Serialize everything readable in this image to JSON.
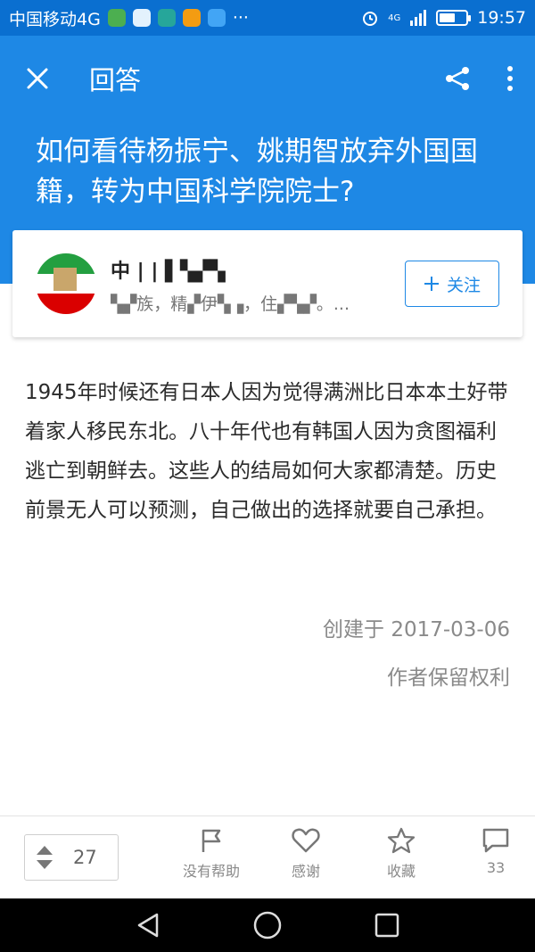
{
  "status_bar": {
    "carrier": "中国移动4G",
    "network": "4G",
    "time": "19:57",
    "battery_level": 0.6,
    "dots": "···"
  },
  "header": {
    "title": "回答",
    "question": "如何看待杨振宁、姚期智放弃外国国籍，转为中国科学院院士?"
  },
  "author": {
    "name": "中 | | ▌▚▞▚",
    "bio": "▚▞族，精▞伊▚▗，住▞▚▞。...",
    "follow_label": "关注"
  },
  "answer": {
    "text": "1945年时候还有日本人因为觉得满洲比日本本土好带着家人移民东北。八十年代也有韩国人因为贪图福利逃亡到朝鲜去。这些人的结局如何大家都清楚。历史前景无人可以预测，自己做出的选择就要自己承担。",
    "created": "创建于 2017-03-06",
    "rights": "作者保留权利"
  },
  "bottom_bar": {
    "vote_count": "27",
    "not_helpful_label": "没有帮助",
    "thanks_label": "感谢",
    "collect_label": "收藏",
    "comments_count": "33"
  },
  "colors": {
    "brand_blue": "#1e88e5",
    "status_blue": "#0a6fd0"
  }
}
